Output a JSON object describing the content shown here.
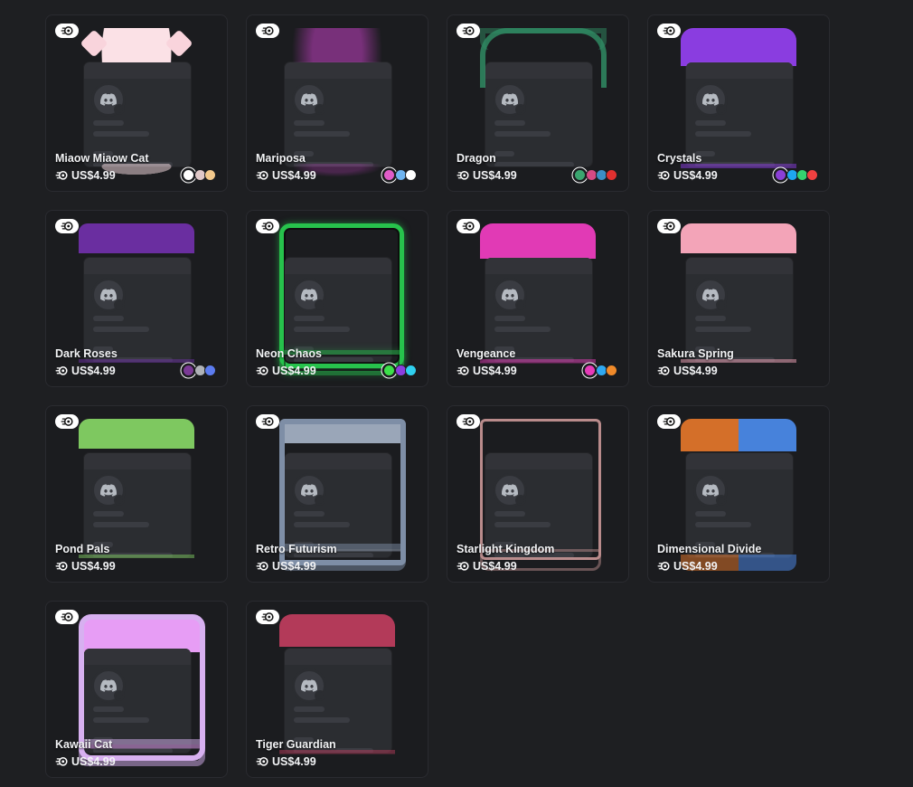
{
  "products": [
    {
      "name": "Miaow Miaow Cat",
      "price": "US$4.99",
      "frame": "f-cat",
      "swatches": [
        "#ffffff",
        "#e0c8c8",
        "#f3c98c"
      ]
    },
    {
      "name": "Mariposa",
      "price": "US$4.99",
      "frame": "f-mari",
      "swatches": [
        "#e05cc8",
        "#6fb4f0",
        "#ffffff"
      ]
    },
    {
      "name": "Dragon",
      "price": "US$4.99",
      "frame": "f-dragon",
      "swatches": [
        "#3aa56f",
        "#d54a84",
        "#3c8ec4",
        "#e0302f"
      ]
    },
    {
      "name": "Crystals",
      "price": "US$4.99",
      "frame": "f-crys",
      "swatches": [
        "#8b3fd6",
        "#1ea7f0",
        "#35d26f",
        "#f04040"
      ]
    },
    {
      "name": "Dark Roses",
      "price": "US$4.99",
      "frame": "f-rose",
      "swatches": [
        "#7b3a96",
        "#b0b3b8",
        "#5c7cf0"
      ]
    },
    {
      "name": "Neon Chaos",
      "price": "US$4.99",
      "frame": "f-neon",
      "swatches": [
        "#3ce04a",
        "#8b3fe0",
        "#2fd0f0"
      ]
    },
    {
      "name": "Vengeance",
      "price": "US$4.99",
      "frame": "f-veng",
      "swatches": [
        "#e63bb8",
        "#2fa8f0",
        "#f08a2a"
      ]
    },
    {
      "name": "Sakura Spring",
      "price": "US$4.99",
      "frame": "f-sakura",
      "swatches": []
    },
    {
      "name": "Pond Pals",
      "price": "US$4.99",
      "frame": "f-pond",
      "swatches": []
    },
    {
      "name": "Retro Futurism",
      "price": "US$4.99",
      "frame": "f-retro",
      "swatches": []
    },
    {
      "name": "Starlight Kingdom",
      "price": "US$4.99",
      "frame": "f-star",
      "swatches": []
    },
    {
      "name": "Dimensional Divide",
      "price": "US$4.99",
      "frame": "f-dim",
      "swatches": []
    },
    {
      "name": "Kawaii Cat",
      "price": "US$4.99",
      "frame": "f-kawaii",
      "swatches": []
    },
    {
      "name": "Tiger Guardian",
      "price": "US$4.99",
      "frame": "f-tiger",
      "swatches": []
    }
  ],
  "icons": {
    "badge": "nitro-badge-icon",
    "price": "nitro-icon",
    "avatar": "discord-logo-icon"
  },
  "colors": {
    "background": "#1e1f22",
    "card": "#1b1c1f",
    "panel": "#2b2d31"
  }
}
